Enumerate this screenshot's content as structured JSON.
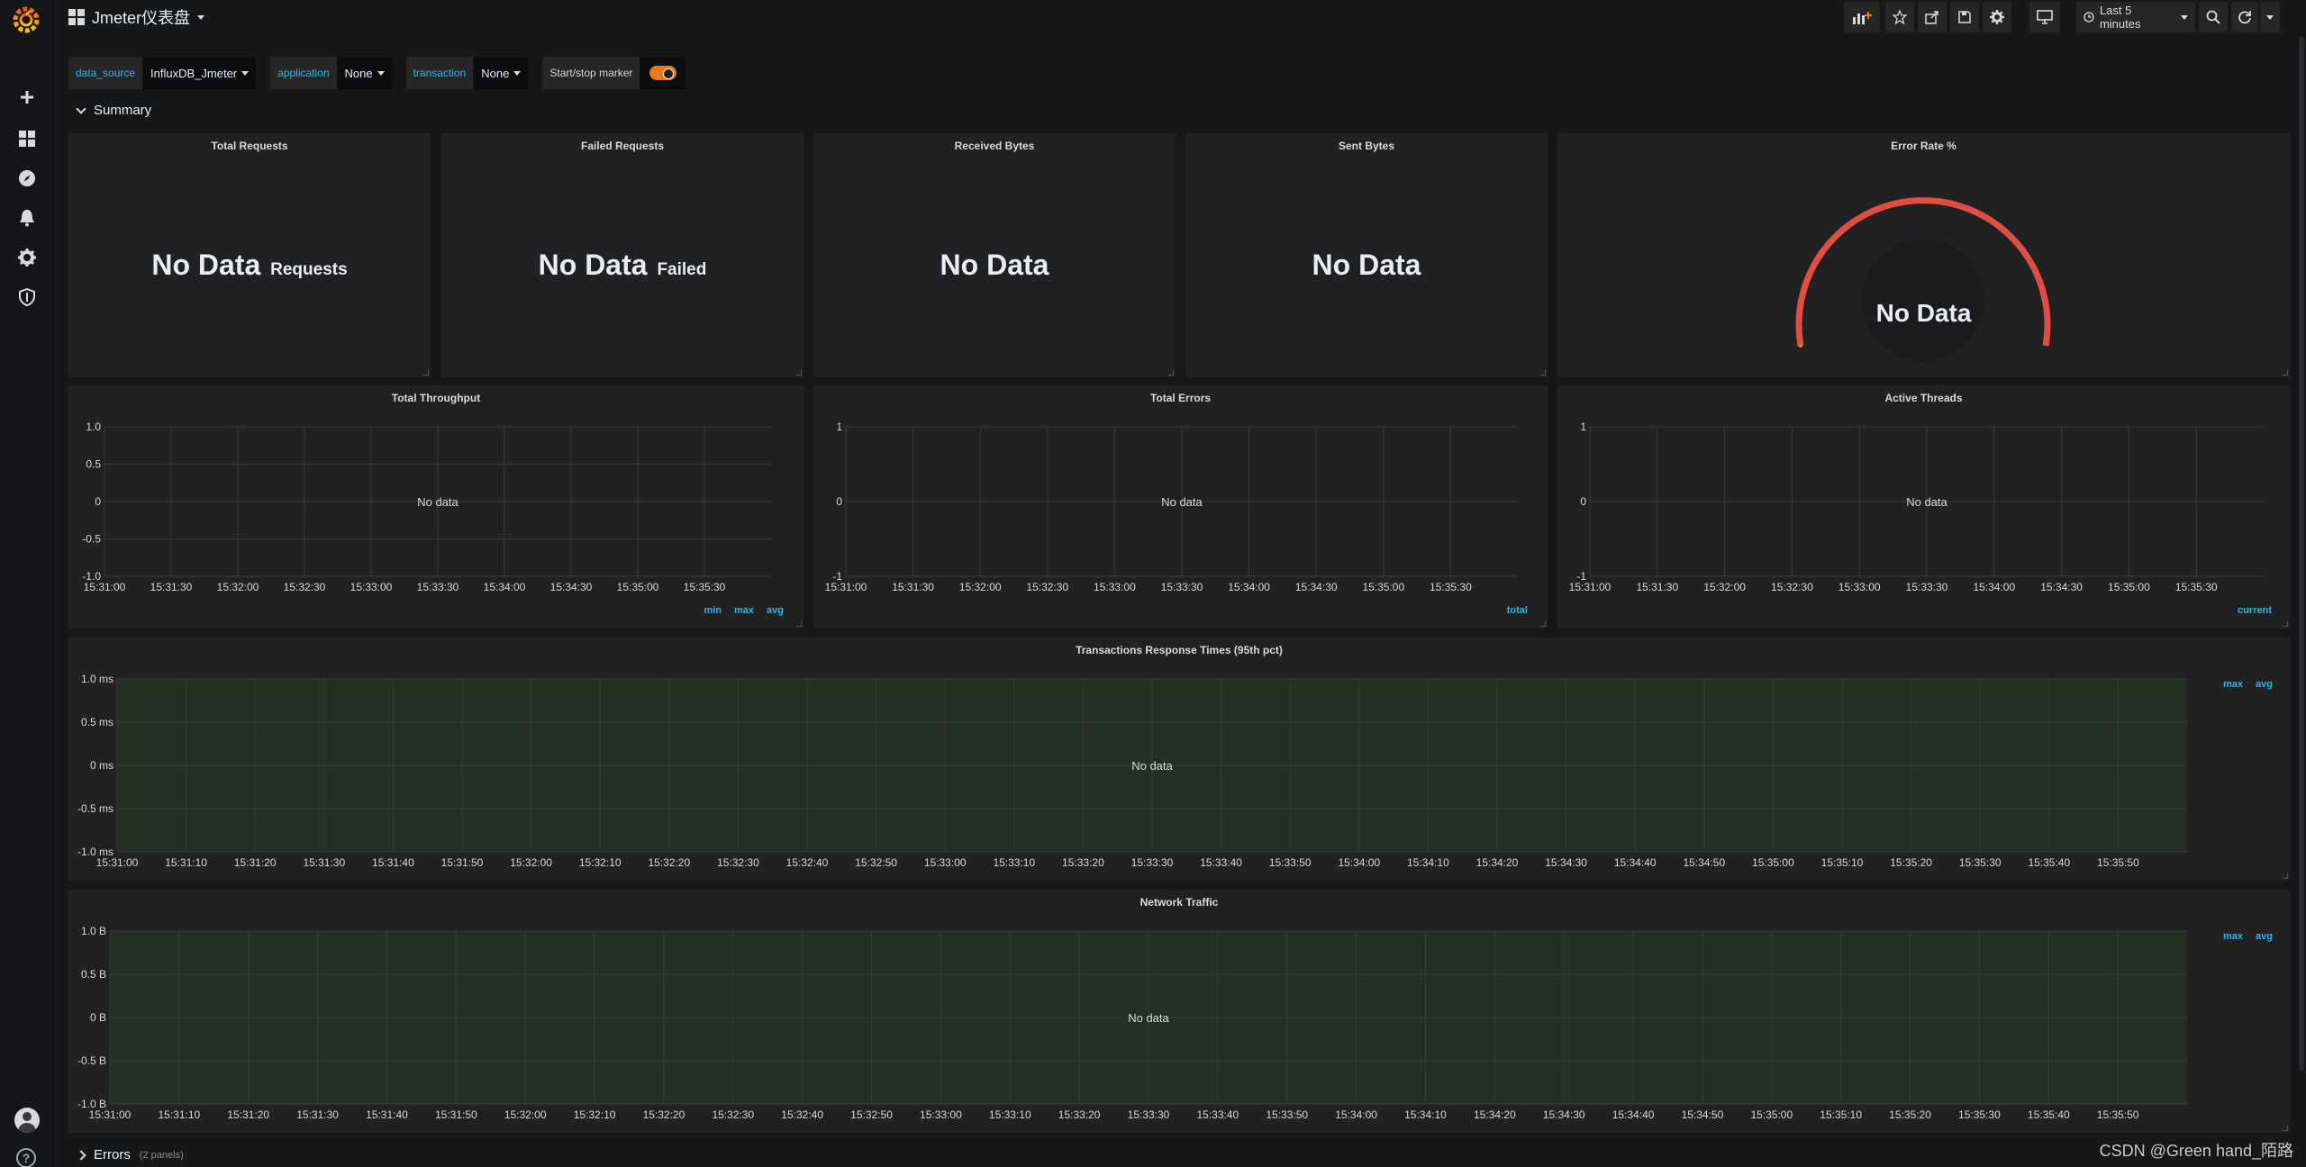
{
  "navbar": {
    "dashboard_title": "Jmeter仪表盘",
    "time_range": "Last 5 minutes"
  },
  "variables": [
    {
      "label": "data_source",
      "value": "InfluxDB_Jmeter"
    },
    {
      "label": "application",
      "value": "None"
    },
    {
      "label": "transaction",
      "value": "None"
    }
  ],
  "annotation_toggle": {
    "label": "Start/stop marker",
    "enabled": true
  },
  "rows": {
    "summary": {
      "title": "Summary"
    },
    "errors": {
      "title": "Errors",
      "subtitle": "(2 panels)"
    }
  },
  "stats": [
    {
      "title": "Total Requests",
      "value": "No Data",
      "unit": "Requests"
    },
    {
      "title": "Failed Requests",
      "value": "No Data",
      "unit": "Failed"
    },
    {
      "title": "Received Bytes",
      "value": "No Data",
      "unit": ""
    },
    {
      "title": "Sent Bytes",
      "value": "No Data",
      "unit": ""
    }
  ],
  "gauge": {
    "title": "Error Rate %",
    "value": "No Data",
    "color": "#e24d42"
  },
  "colors": {
    "accent": "#33b5e5",
    "toggle": "#eb7b18",
    "panel_bg": "#212124",
    "plot_bg": "#223024"
  },
  "graphs": {
    "throughput": {
      "title": "Total Throughput",
      "no_data": "No data",
      "y_ticks": [
        "1.0",
        "0.5",
        "0",
        "-0.5",
        "-1.0"
      ],
      "x_ticks": [
        "15:31:00",
        "15:31:30",
        "15:32:00",
        "15:32:30",
        "15:33:00",
        "15:33:30",
        "15:34:00",
        "15:34:30",
        "15:35:00",
        "15:35:30"
      ],
      "legend": [
        "min",
        "max",
        "avg"
      ]
    },
    "errors": {
      "title": "Total Errors",
      "no_data": "No data",
      "y_ticks": [
        "1",
        "0",
        "-1"
      ],
      "x_ticks": [
        "15:31:00",
        "15:31:30",
        "15:32:00",
        "15:32:30",
        "15:33:00",
        "15:33:30",
        "15:34:00",
        "15:34:30",
        "15:35:00",
        "15:35:30"
      ],
      "legend": [
        "total"
      ]
    },
    "threads": {
      "title": "Active Threads",
      "no_data": "No data",
      "y_ticks": [
        "1",
        "0",
        "-1"
      ],
      "x_ticks": [
        "15:31:00",
        "15:31:30",
        "15:32:00",
        "15:32:30",
        "15:33:00",
        "15:33:30",
        "15:34:00",
        "15:34:30",
        "15:35:00",
        "15:35:30"
      ],
      "legend": [
        "current"
      ]
    },
    "response_times": {
      "title": "Transactions Response Times (95th pct)",
      "no_data": "No data",
      "y_ticks": [
        "1.0 ms",
        "0.5 ms",
        "0 ms",
        "-0.5 ms",
        "-1.0 ms"
      ],
      "x_ticks": [
        "15:31:00",
        "15:31:10",
        "15:31:20",
        "15:31:30",
        "15:31:40",
        "15:31:50",
        "15:32:00",
        "15:32:10",
        "15:32:20",
        "15:32:30",
        "15:32:40",
        "15:32:50",
        "15:33:00",
        "15:33:10",
        "15:33:20",
        "15:33:30",
        "15:33:40",
        "15:33:50",
        "15:34:00",
        "15:34:10",
        "15:34:20",
        "15:34:30",
        "15:34:40",
        "15:34:50",
        "15:35:00",
        "15:35:10",
        "15:35:20",
        "15:35:30",
        "15:35:40",
        "15:35:50"
      ],
      "legend": [
        "max",
        "avg"
      ]
    },
    "network": {
      "title": "Network Traffic",
      "no_data": "No data",
      "y_ticks": [
        "1.0 B",
        "0.5 B",
        "0 B",
        "-0.5 B",
        "-1.0 B"
      ],
      "x_ticks": [
        "15:31:00",
        "15:31:10",
        "15:31:20",
        "15:31:30",
        "15:31:40",
        "15:31:50",
        "15:32:00",
        "15:32:10",
        "15:32:20",
        "15:32:30",
        "15:32:40",
        "15:32:50",
        "15:33:00",
        "15:33:10",
        "15:33:20",
        "15:33:30",
        "15:33:40",
        "15:33:50",
        "15:34:00",
        "15:34:10",
        "15:34:20",
        "15:34:30",
        "15:34:40",
        "15:34:50",
        "15:35:00",
        "15:35:10",
        "15:35:20",
        "15:35:30",
        "15:35:40",
        "15:35:50"
      ],
      "legend": [
        "max",
        "avg"
      ]
    }
  },
  "watermark": "CSDN @Green hand_陌路"
}
